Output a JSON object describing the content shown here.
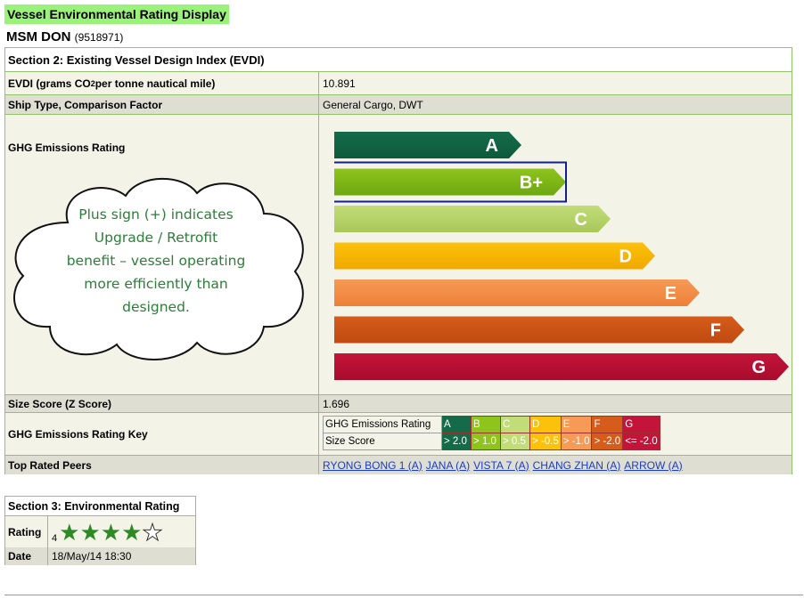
{
  "page_title": "Vessel Environmental Rating Display",
  "vessel": {
    "name": "MSM DON",
    "imo": "(9518971)"
  },
  "section2": {
    "title": "Section 2: Existing Vessel Design Index (EVDI)",
    "evdi_label_pre": "EVDI (grams CO",
    "evdi_label_sub": "2",
    "evdi_label_post": " per tonne nautical mile)",
    "evdi_value": "10.891",
    "ship_type_label": "Ship Type, Comparison Factor",
    "ship_type_value": "General Cargo, DWT",
    "ghg_label": "GHG Emissions Rating",
    "size_label": "Size Score (Z Score)",
    "size_value": "1.696",
    "key_label": "GHG Emissions Rating Key",
    "peers_label": "Top Rated Peers",
    "peers": [
      "RYONG BONG 1 (A)",
      "JANA (A)",
      "VISTA 7 (A)",
      "CHANG ZHAN (A)",
      "ARROW (A)"
    ]
  },
  "rating_bars": [
    {
      "letter": "A",
      "color": "#146b4a",
      "color2": "#0d5a3c",
      "width_units": 210,
      "selected": false
    },
    {
      "letter": "B+",
      "color": "#8ec41c",
      "color2": "#6ea812",
      "width_units": 260,
      "selected": true
    },
    {
      "letter": "C",
      "color": "#c2dc78",
      "color2": "#a8c85a",
      "width_units": 310,
      "selected": false
    },
    {
      "letter": "D",
      "color": "#fcc20a",
      "color2": "#f0a800",
      "width_units": 360,
      "selected": false
    },
    {
      "letter": "E",
      "color": "#f69a56",
      "color2": "#ee8038",
      "width_units": 410,
      "selected": false
    },
    {
      "letter": "F",
      "color": "#d55c1a",
      "color2": "#c04a10",
      "width_units": 460,
      "selected": false
    },
    {
      "letter": "G",
      "color": "#c4143a",
      "color2": "#a80c2c",
      "width_units": 510,
      "selected": false
    }
  ],
  "rating_key": {
    "row1_label": "GHG Emissions Rating",
    "row2_label": "Size Score",
    "cells": [
      {
        "grade": "A",
        "score": "> 2.0",
        "color": "#146b4a"
      },
      {
        "grade": "B",
        "score": "> 1.0",
        "color": "#8ec41c"
      },
      {
        "grade": "C",
        "score": "> 0.5",
        "color": "#c2dc78"
      },
      {
        "grade": "D",
        "score": "> -0.5",
        "color": "#fcc20a"
      },
      {
        "grade": "E",
        "score": "> -1.0",
        "color": "#f69a56"
      },
      {
        "grade": "F",
        "score": "> -2.0",
        "color": "#d55c1a"
      },
      {
        "grade": "G",
        "score": "<= -2.0",
        "color": "#c4143a"
      }
    ]
  },
  "callout": {
    "lines": [
      "Plus sign (+) indicates",
      "Upgrade / Retrofit",
      "benefit – vessel operating",
      "more efficiently than",
      "designed."
    ]
  },
  "section3": {
    "title": "Section 3: Environmental Rating",
    "rating_label": "Rating",
    "rating_value": "4",
    "stars_filled": 4,
    "stars_total": 5,
    "date_label": "Date",
    "date_value": "18/May/14 18:30"
  },
  "colors": {
    "accent_green": "#9bf27a",
    "border_green": "#8fc46b",
    "link": "#1a3cc8",
    "callout_text": "#2e7d3a"
  }
}
